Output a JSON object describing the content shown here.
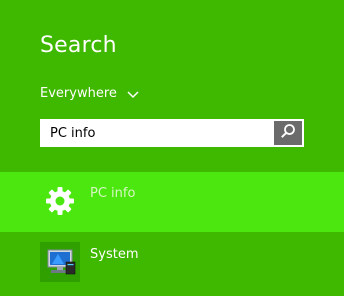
{
  "panel": {
    "title": "Search",
    "scope_label": "Everywhere"
  },
  "search": {
    "query": "PC info"
  },
  "results": [
    {
      "label": "PC info",
      "icon": "gear-icon",
      "selected": true
    },
    {
      "label": "System",
      "icon": "system-monitor-icon",
      "selected": false
    }
  ],
  "colors": {
    "background": "#3fb800",
    "selected_row": "#4be70f",
    "search_button": "#6b6b6b"
  }
}
